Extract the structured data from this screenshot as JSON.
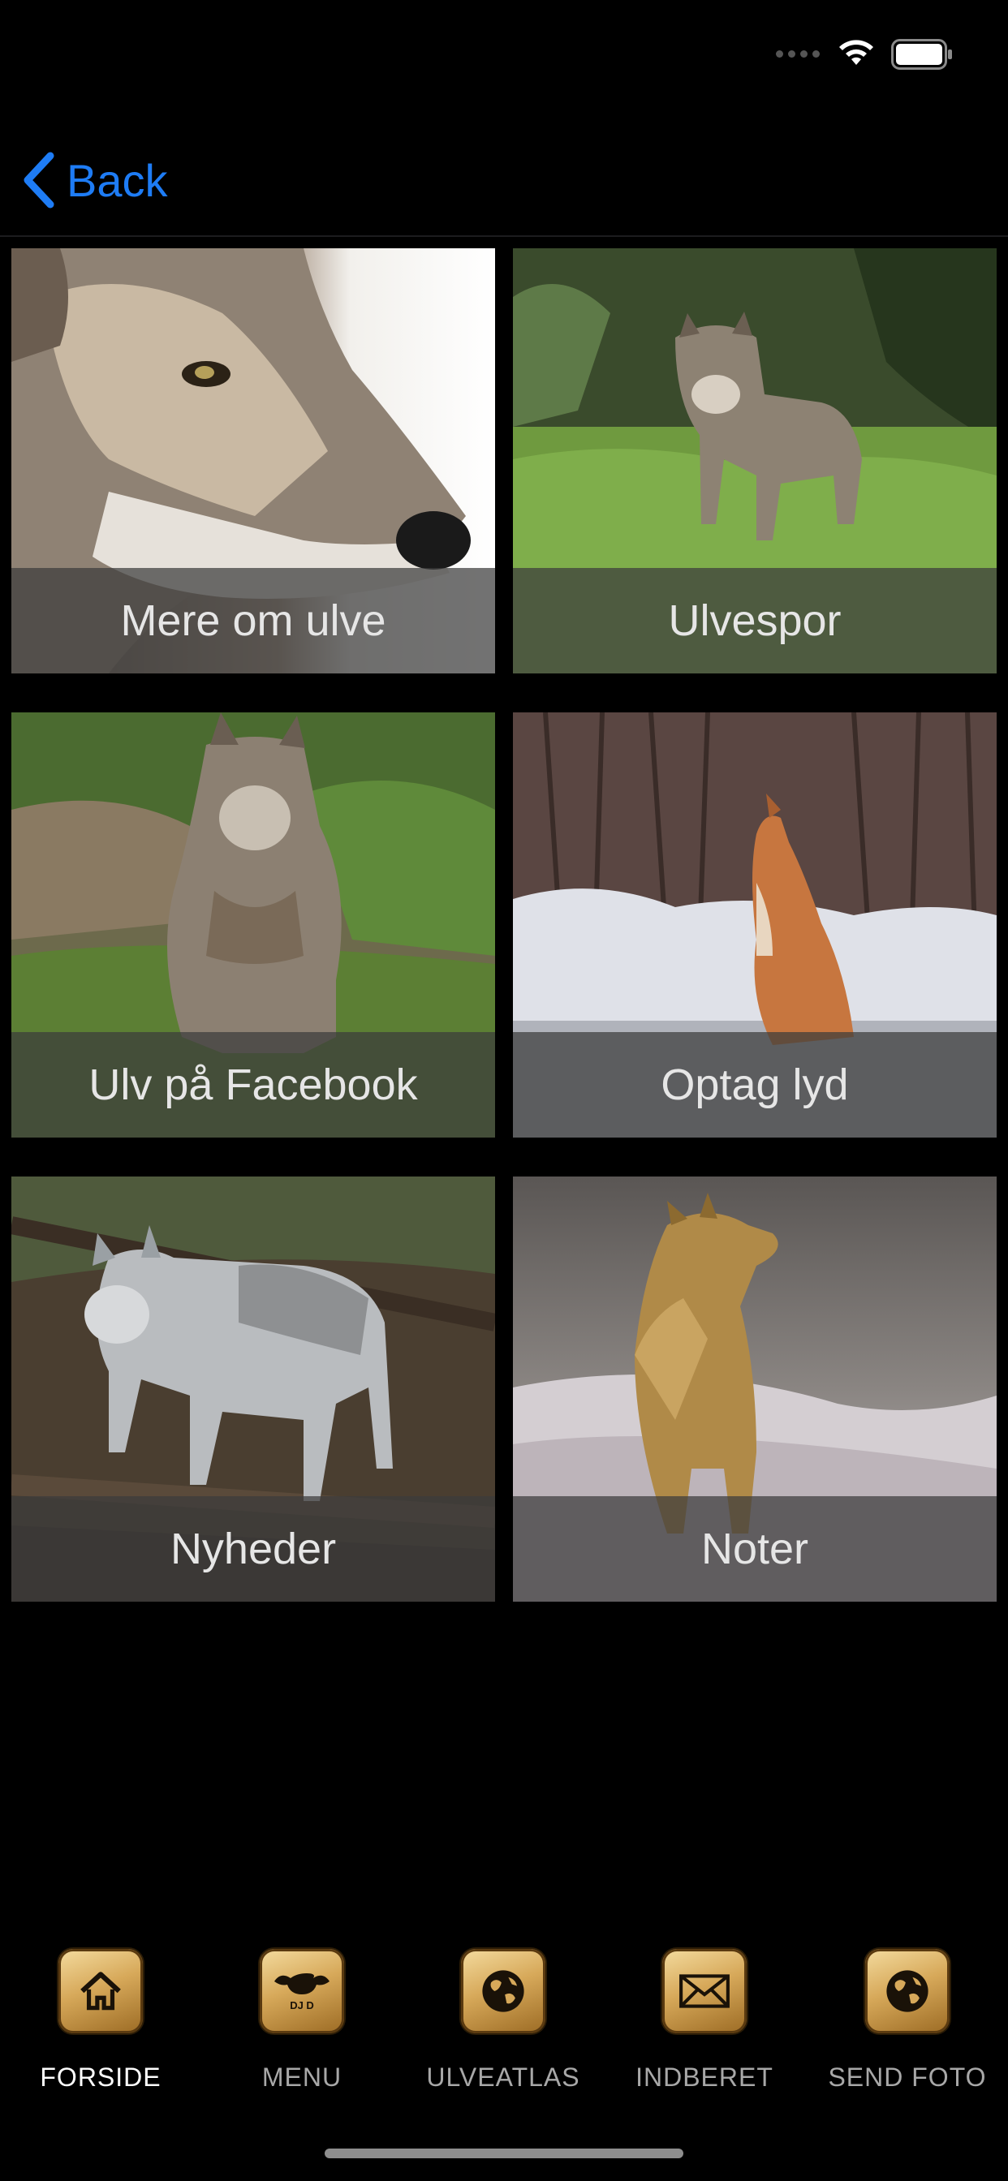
{
  "nav": {
    "back_label": "Back"
  },
  "tiles": [
    {
      "label": "Mere om ulve",
      "photo": "wolf-head-closeup"
    },
    {
      "label": "Ulvespor",
      "photo": "wolf-in-forest"
    },
    {
      "label": "Ulv på Facebook",
      "photo": "wolf-sitting-grass"
    },
    {
      "label": "Optag lyd",
      "photo": "red-wolf-howling-snow"
    },
    {
      "label": "Nyheder",
      "photo": "grey-wolf-walking-woods"
    },
    {
      "label": "Noter",
      "photo": "wolf-howling-snowy-field"
    }
  ],
  "tabbar": {
    "items": [
      {
        "label": "FORSIDE",
        "icon": "home-icon",
        "active": true
      },
      {
        "label": "MENU",
        "icon": "buffalo-logo-icon",
        "active": false
      },
      {
        "label": "ULVEATLAS",
        "icon": "globe-icon",
        "active": false
      },
      {
        "label": "INDBERET",
        "icon": "envelope-icon",
        "active": false
      },
      {
        "label": "SEND FOTO",
        "icon": "globe-icon",
        "active": false
      }
    ]
  },
  "colors": {
    "accent": "#1e7cf5",
    "background": "#000000",
    "caption_overlay": "#3c3c3c",
    "tab_icon_gold": "#d7a95a"
  }
}
